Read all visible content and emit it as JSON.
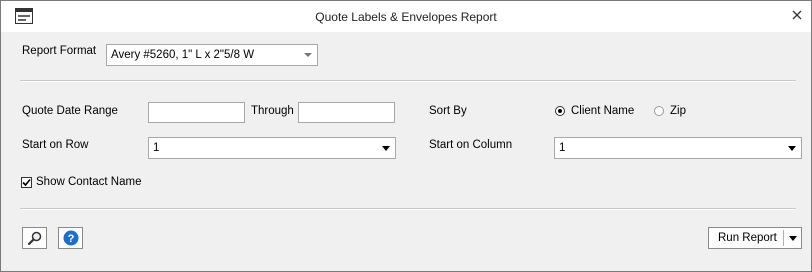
{
  "window": {
    "title": "Quote Labels & Envelopes Report",
    "close_glyph": "✕"
  },
  "report_format": {
    "label": "Report Format",
    "selected": "Avery #5260, 1\" L x 2\"5/8 W"
  },
  "date_range": {
    "label": "Quote Date Range",
    "from_value": "",
    "through_label": "Through",
    "to_value": ""
  },
  "sort_by": {
    "label": "Sort By",
    "options": [
      {
        "label": "Client Name",
        "selected": true
      },
      {
        "label": "Zip",
        "selected": false
      }
    ]
  },
  "start_row": {
    "label": "Start on Row",
    "selected": "1"
  },
  "start_column": {
    "label": "Start on Column",
    "selected": "1"
  },
  "show_contact": {
    "label": "Show Contact Name",
    "checked": true
  },
  "footer": {
    "run_report_label": "Run Report"
  },
  "icons": {
    "window": "window-icon",
    "preview": "magnifier-icon",
    "help": "help-icon",
    "close": "close-icon"
  },
  "colors": {
    "help_blue": "#1c6fc9",
    "dialog_bg": "#f0f0f0"
  }
}
